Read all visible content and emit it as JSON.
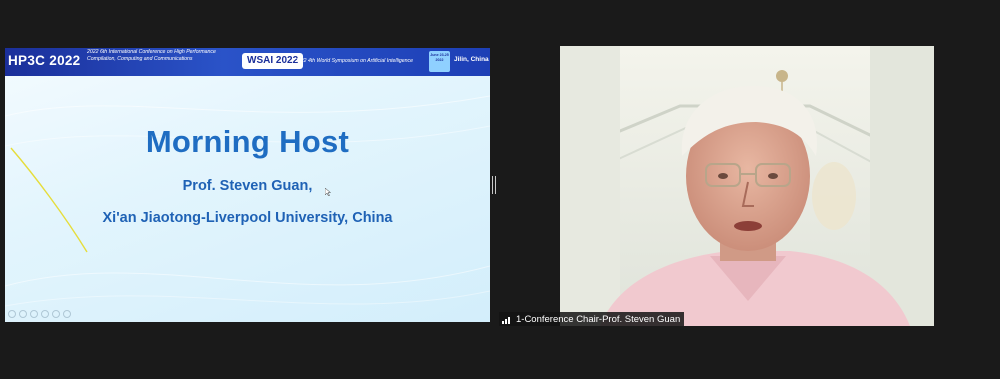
{
  "slide": {
    "header": {
      "hp3c_logo": "HP3C 2022",
      "hp3c_desc": "2022 6th International Conference on High Performance Compilation, Computing and Communications",
      "wsai_badge": "WSAI 2022",
      "wsai_desc": "2022 4th World Symposium on Artificial Intelligence",
      "date_badge": "June 23-25 2022",
      "location": "Jilin, China"
    },
    "title": "Morning Host",
    "line1": "Prof. Steven Guan,",
    "line2": "Xi'an Jiaotong-Liverpool University, China"
  },
  "video": {
    "participant_name": "1-Conference Chair-Prof. Steven Guan"
  },
  "colors": {
    "background": "#1a1a1a",
    "slide_header": "#1b2f9a",
    "slide_text": "#1f6dc2",
    "swoosh": "#e6dd3a"
  }
}
